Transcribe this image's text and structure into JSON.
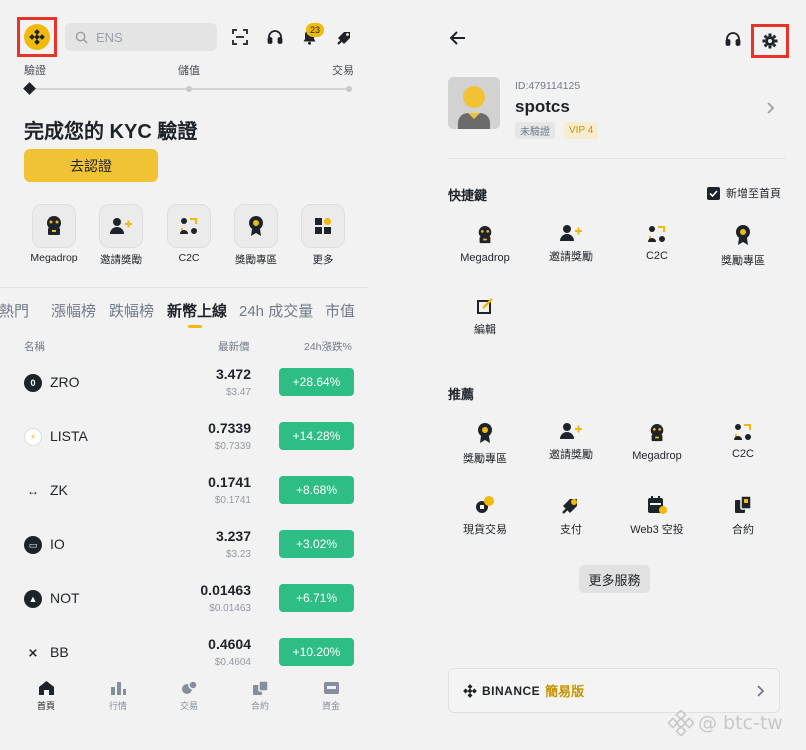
{
  "left": {
    "search_placeholder": "ENS",
    "notification_count": "23",
    "steps": [
      "驗證",
      "儲值",
      "交易"
    ],
    "kyc_title": "完成您的 KYC 驗證",
    "kyc_button": "去認證",
    "quick_icons": [
      "Megadrop",
      "邀請獎勵",
      "C2C",
      "獎勵專區",
      "更多"
    ],
    "market_tabs": [
      "熱門",
      "漲幅榜",
      "跌幅榜",
      "新幣上線",
      "24h 成交量",
      "市值"
    ],
    "active_tab": "新幣上線",
    "columns": {
      "name": "名稱",
      "price": "最新價",
      "change": "24h漲跌%"
    },
    "rows": [
      {
        "icon": "zro-icon",
        "name": "ZRO",
        "price": "3.472",
        "sub": "$3.47",
        "change": "+28.64%"
      },
      {
        "icon": "lista-icon",
        "name": "LISTA",
        "price": "0.7339",
        "sub": "$0.7339",
        "change": "+14.28%"
      },
      {
        "icon": "zk-icon",
        "name": "ZK",
        "price": "0.1741",
        "sub": "$0.1741",
        "change": "+8.68%"
      },
      {
        "icon": "io-icon",
        "name": "IO",
        "price": "3.237",
        "sub": "$3.23",
        "change": "+3.02%"
      },
      {
        "icon": "not-icon",
        "name": "NOT",
        "price": "0.01463",
        "sub": "$0.01463",
        "change": "+6.71%"
      },
      {
        "icon": "bb-icon",
        "name": "BB",
        "price": "0.4604",
        "sub": "$0.4604",
        "change": "+10.20%"
      }
    ],
    "bottom_nav": [
      "首頁",
      "行情",
      "交易",
      "合約",
      "資金"
    ],
    "change_color": "#2ebd85",
    "accent": "#f0b90b"
  },
  "right": {
    "uid": "ID:479114125",
    "username": "spotcs",
    "tag_unverified": "未驗證",
    "tag_vip": "VIP 4",
    "shortcuts_title": "快捷鍵",
    "add_home_label": "新增至首頁",
    "shortcuts": [
      "Megadrop",
      "邀請獎勵",
      "C2C",
      "獎勵專區",
      "編輯"
    ],
    "recommend_title": "推薦",
    "recommend": [
      "獎勵專區",
      "邀請獎勵",
      "Megadrop",
      "C2C",
      "現貨交易",
      "支付",
      "Web3 空投",
      "合約"
    ],
    "more_services": "更多服務",
    "lite_brand": "BINANCE",
    "lite_label": "簡易版"
  },
  "watermark": "@ btc-tw"
}
